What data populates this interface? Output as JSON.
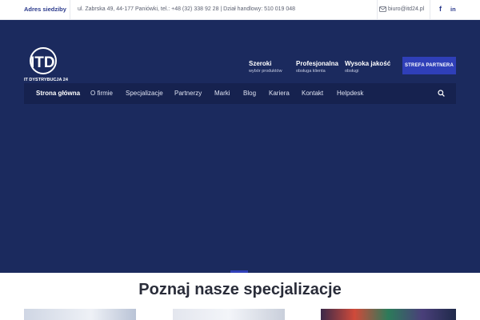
{
  "topbar": {
    "address_label": "Adres siedziby",
    "address_text": "ul. Zabrska 49, 44-177 Paniówki, tel.: +48 (32) 338 92 28 | Dział handlowy: 510 019 048",
    "email": "biuro@itd24.pl",
    "social": {
      "facebook": "f",
      "linkedin": "in"
    }
  },
  "brand": {
    "logo_text": "ITD",
    "tagline": "IT DYSTRYBUCJA 24"
  },
  "features": [
    {
      "title": "Szeroki",
      "subtitle": "wybór produktów"
    },
    {
      "title": "Profesjonalna",
      "subtitle": "obsługa klienta"
    },
    {
      "title": "Wysoka jakość",
      "subtitle": "obsługi"
    }
  ],
  "partner_button": "STREFA PARTNERA",
  "nav": {
    "items": [
      "Strona główna",
      "O firmie",
      "Specjalizacje",
      "Partnerzy",
      "Marki",
      "Blog",
      "Kariera",
      "Kontakt",
      "Helpdesk"
    ],
    "active_index": 0,
    "search_icon": "search-icon"
  },
  "section": {
    "title": "Poznaj nasze specjalizacje"
  },
  "colors": {
    "hero_bg": "#1b2a5e",
    "nav_bg": "#16224f",
    "accent": "#2f3fb8",
    "brand_text": "#2b3a8c"
  }
}
